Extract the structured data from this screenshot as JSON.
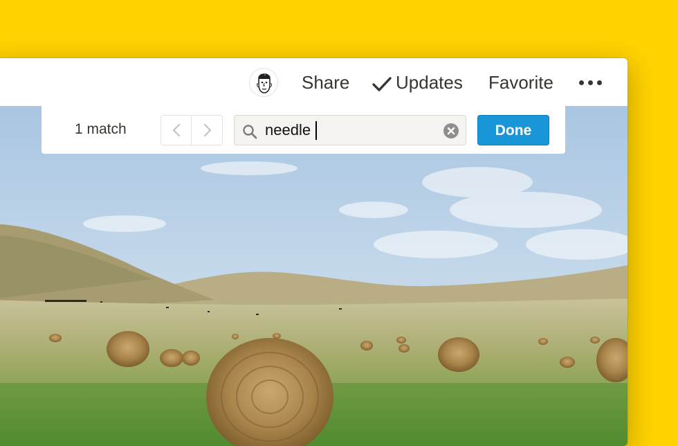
{
  "topbar": {
    "share_label": "Share",
    "updates_label": "Updates",
    "favorite_label": "Favorite",
    "more_icon": "ellipsis-icon",
    "updates_icon": "checkmark-icon"
  },
  "findbar": {
    "match_count": "1 match",
    "search_query": "needle",
    "done_label": "Done",
    "prev_icon": "chevron-left-icon",
    "next_icon": "chevron-right-icon",
    "search_icon": "search-icon",
    "clear_icon": "clear-icon"
  },
  "colors": {
    "background": "#FFD200",
    "done_button": "#1896D8",
    "text": "#37352F"
  }
}
